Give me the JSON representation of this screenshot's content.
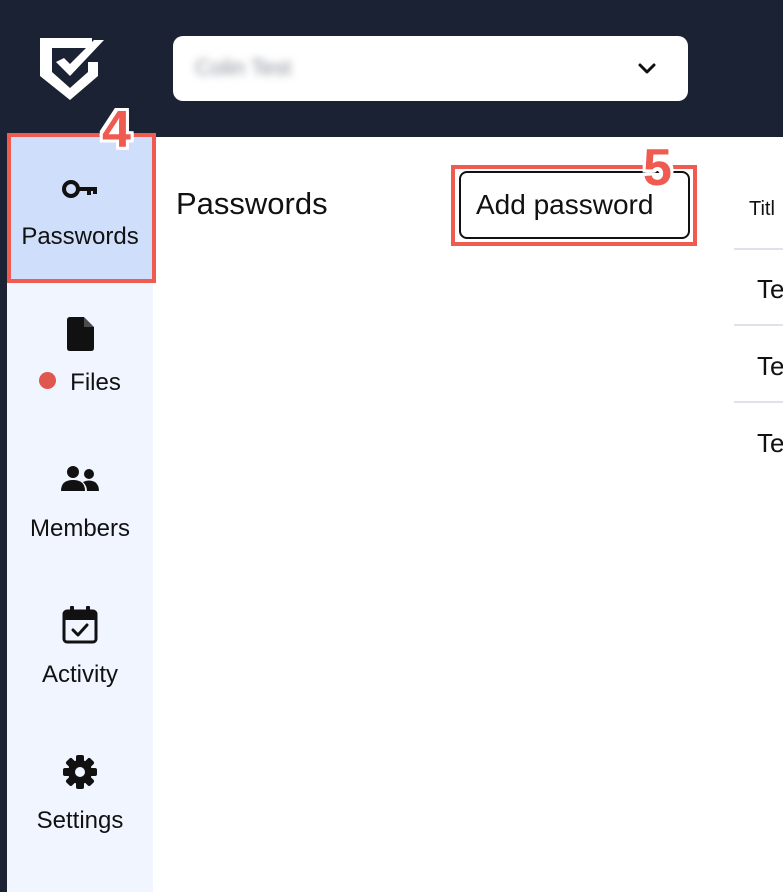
{
  "header": {
    "workspace_name": "Colin Test",
    "icons": {
      "logo": "shield-check-logo",
      "dropdown": "chevron-down-icon"
    }
  },
  "sidebar": {
    "items": [
      {
        "label": "Passwords",
        "icon": "key-icon",
        "active": true
      },
      {
        "label": "Files",
        "icon": "file-icon",
        "has_badge": true
      },
      {
        "label": "Members",
        "icon": "members-icon"
      },
      {
        "label": "Activity",
        "icon": "calendar-check-icon"
      },
      {
        "label": "Settings",
        "icon": "gear-icon"
      }
    ]
  },
  "main": {
    "title": "Passwords",
    "add_button": "Add password",
    "table": {
      "column_header": "Titl",
      "rows": [
        "Te",
        "Te",
        "Te"
      ]
    }
  },
  "annotations": {
    "step_4": "4",
    "step_5": "5"
  },
  "colors": {
    "topbar": "#1b2233",
    "sidebar": "#f0f5ff",
    "sidebar_active": "#cfdffb",
    "annotation": "#ef5a51",
    "badge": "#e0574f"
  }
}
